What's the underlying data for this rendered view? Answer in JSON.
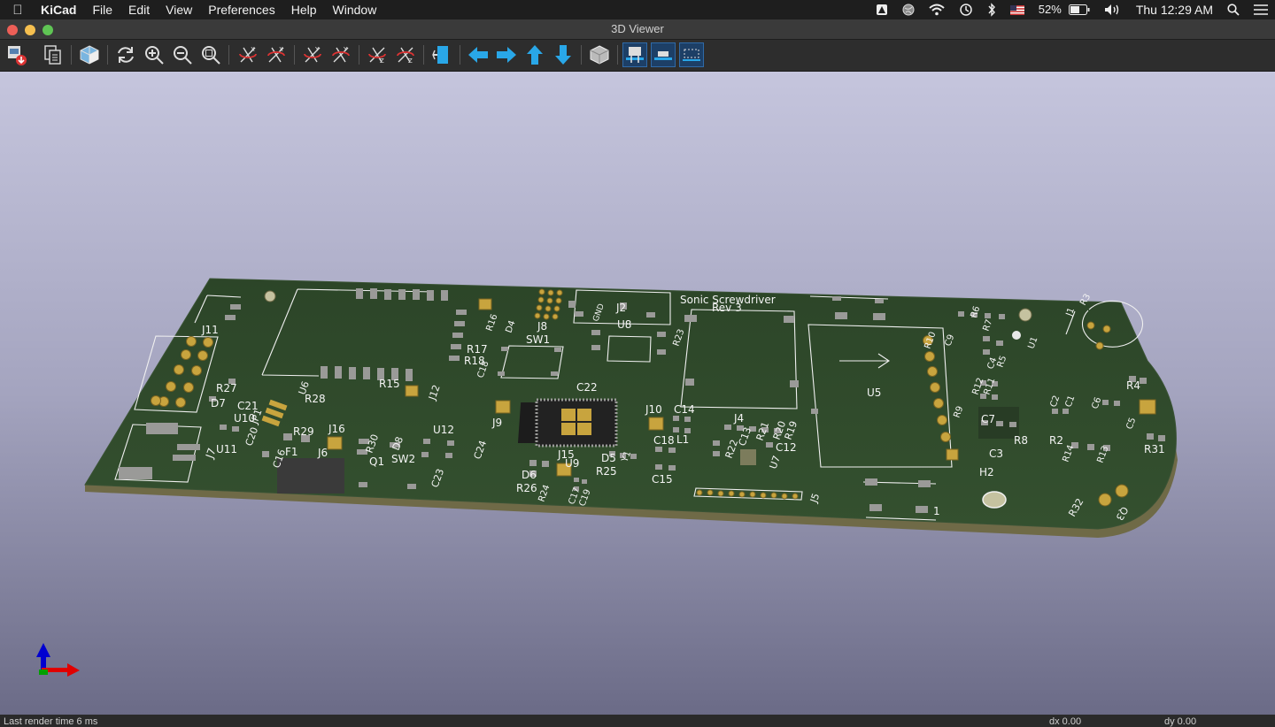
{
  "menubar": {
    "app_name": "KiCad",
    "menus": [
      "File",
      "Edit",
      "View",
      "Preferences",
      "Help",
      "Window"
    ],
    "battery": "52%",
    "clock": "Thu 12:29 AM"
  },
  "window": {
    "title": "3D Viewer"
  },
  "toolbar": {
    "icons": [
      "export-icon",
      "copy-icon",
      "board-cube-icon",
      "reload-icon",
      "zoom-in-icon",
      "zoom-out-icon",
      "zoom-fit-icon",
      "rotate-x-cw-icon",
      "rotate-x-ccw-icon",
      "rotate-y-cw-icon",
      "rotate-y-ccw-icon",
      "rotate-z-cw-icon",
      "rotate-z-ccw-icon",
      "flip-board-icon",
      "pan-left-icon",
      "pan-right-icon",
      "pan-up-icon",
      "pan-down-icon",
      "ortho-icon",
      "render-footprint-tht-icon",
      "render-footprint-smd-icon",
      "render-footprint-virtual-icon"
    ],
    "active": [
      "render-footprint-tht-icon",
      "render-footprint-smd-icon",
      "render-footprint-virtual-icon"
    ]
  },
  "board": {
    "title_line1": "Sonic Screwdriver",
    "title_line2": "Rev 3",
    "references": [
      "J11",
      "J7",
      "D7",
      "R27",
      "C21",
      "U10",
      "JP1",
      "C20",
      "U11",
      "C16",
      "F1",
      "R28",
      "U6",
      "R29",
      "J16",
      "J6",
      "R30",
      "Q1",
      "D8",
      "SW2",
      "U12",
      "C23",
      "C24",
      "R15",
      "J12",
      "R17",
      "R18",
      "C18",
      "R16",
      "D4",
      "J8",
      "SW1",
      "J9",
      "C22",
      "U8",
      "R23",
      "J2",
      "GND",
      "J15",
      "U9",
      "D6",
      "R26",
      "R24",
      "C17",
      "C19",
      "D5",
      "Y1",
      "R25",
      "J10",
      "C14",
      "L1",
      "C18",
      "C15",
      "J4",
      "R22",
      "C13",
      "R21",
      "R20",
      "R19",
      "U7",
      "C12",
      "J5",
      "U5",
      "R10",
      "C9",
      "R9",
      "R12",
      "R11",
      "C7",
      "C3",
      "R8",
      "H2",
      "C2",
      "C1",
      "C6",
      "C5",
      "R2",
      "R14",
      "R13",
      "R31",
      "R32",
      "Q3",
      "J1",
      "R3",
      "R4",
      "U1",
      "R6",
      "R7",
      "R5",
      "C4",
      "1"
    ],
    "colors": {
      "soldermask": "#2f4a2c",
      "edge": "#6f6a47",
      "pads_gold": "#c8a43e",
      "pads_silver": "#9a9a98",
      "silkscreen": "#f0f0f0"
    }
  },
  "status": {
    "render_time": "Last render time 6 ms",
    "dx": "dx 0.00",
    "dy": "dy 0.00"
  }
}
